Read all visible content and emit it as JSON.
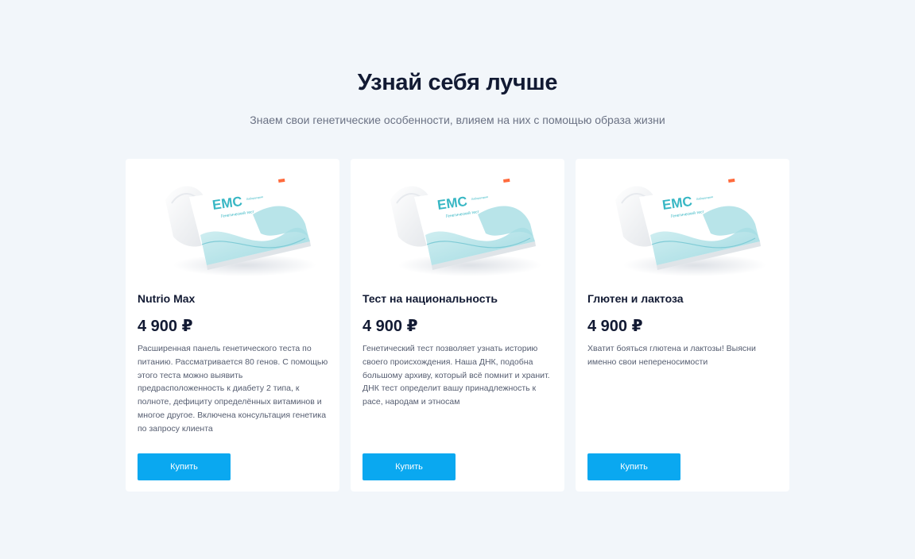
{
  "section": {
    "title": "Узнай себя лучше",
    "subtitle": "Знаем свои генетические особенности, влияем на них с помощью образа жизни"
  },
  "products": [
    {
      "name": "Nutrio Max",
      "price": "4 900 ₽",
      "description": "Расширенная панель генетического теста по питанию. Рассматривается 80 генов. С помощью этого теста можно выявить предрасположенность к диабету 2 типа, к полноте, дефициту определённых витаминов и многое другое. Включена консультация генетика по запросу клиента",
      "button_label": "Купить",
      "image_icon": "dna-test-kit-box-image"
    },
    {
      "name": "Тест на национальность",
      "price": "4 900 ₽",
      "description": "Генетический тест позволяет узнать историю своего происхождения. Наша ДНК, подобна большому архиву, который всё помнит и хранит. ДНК тест определит вашу принадлежность к расе, народам и этносам",
      "button_label": "Купить",
      "image_icon": "dna-test-kit-box-image"
    },
    {
      "name": "Глютен и лактоза",
      "price": "4 900 ₽",
      "description": "Хватит бояться глютена и лактозы! Выясни именно свои непереносимости",
      "button_label": "Купить",
      "image_icon": "dna-test-kit-box-image"
    }
  ],
  "colors": {
    "background": "#f2f6fa",
    "card": "#ffffff",
    "accent": "#0aa8f0",
    "heading": "#121a33",
    "muted_text": "#6b7284"
  },
  "kit_box": {
    "brand": "EMC",
    "subtitle": "Генетический тест"
  }
}
